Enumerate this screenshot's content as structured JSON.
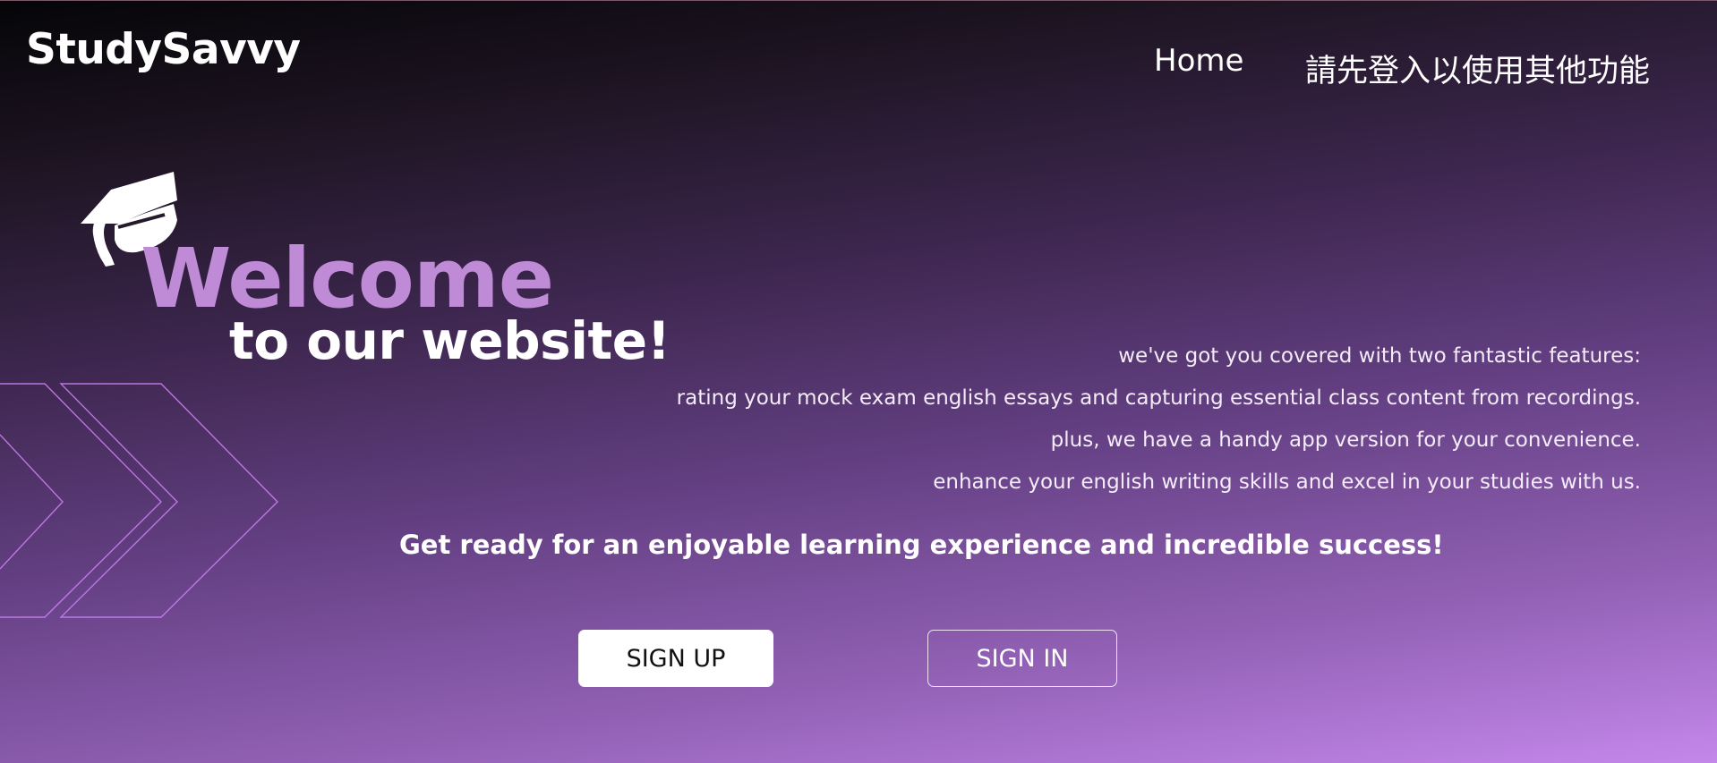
{
  "brand": {
    "name": "StudySavvy"
  },
  "nav": {
    "home": "Home",
    "login_notice": "請先登入以使用其他功能"
  },
  "hero": {
    "welcome": "Welcome",
    "subtitle": "to our website!",
    "icon": "graduation-cap-icon",
    "accent_color": "#c08bd6"
  },
  "features": [
    "we've got you covered with two fantastic features:",
    "rating your mock exam english essays and capturing essential class content from recordings.",
    "plus, we have a handy app version for your convenience.",
    "enhance your english writing skills and excel in your studies with us."
  ],
  "tagline": "Get ready for an enjoyable learning experience and incredible success!",
  "actions": {
    "signup": "SIGN UP",
    "signin": "SIGN IN"
  },
  "decoration": {
    "icon": "chevron-outline-icon",
    "stroke_color": "#c77ef0"
  }
}
